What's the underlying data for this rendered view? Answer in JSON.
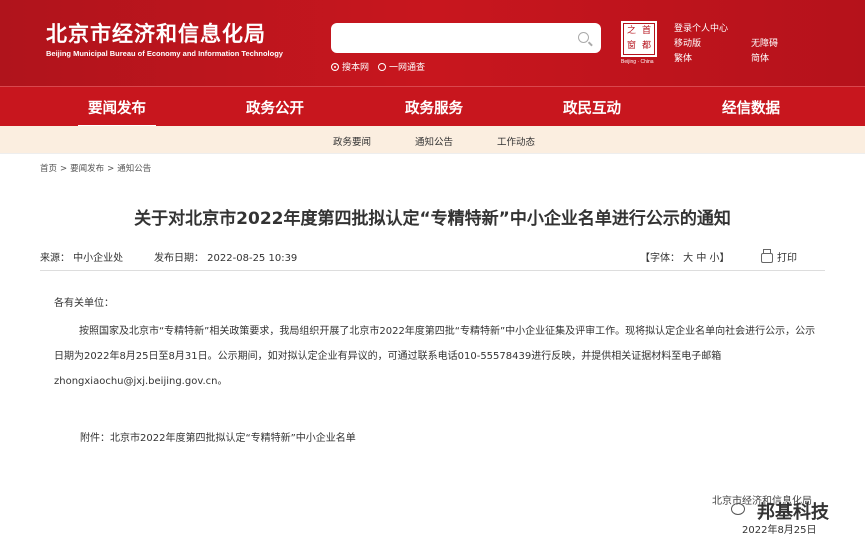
{
  "header": {
    "logo_cn": "北京市经济和信息化局",
    "logo_en": "Beijing Municipal Bureau of Economy and Information Technology",
    "search_placeholder": "",
    "scope_site": "搜本网",
    "scope_all": "一网通查",
    "seal_chars": [
      "首",
      "之",
      "都",
      "窗"
    ],
    "seal_caption": "Beijing · China",
    "links": {
      "login": "登录个人中心",
      "mobile": "移动版",
      "accessible": "无障碍",
      "traditional": "繁体",
      "simplified": "简体"
    }
  },
  "nav": {
    "items": [
      "要闻发布",
      "政务公开",
      "政务服务",
      "政民互动",
      "经信数据"
    ],
    "active": "要闻发布"
  },
  "subnav": {
    "items": [
      "政务要闻",
      "通知公告",
      "工作动态"
    ]
  },
  "breadcrumb": [
    "首页",
    "要闻发布",
    "通知公告"
  ],
  "breadcrumb_sep": ">",
  "article": {
    "title": "关于对北京市2022年度第四批拟认定“专精特新”中小企业名单进行公示的通知",
    "source": "来源：   中小企业处",
    "date": "发布日期：  2022-08-25 10:39",
    "font_size_label": "【字体：  大  中  小】",
    "print_label": "打印",
    "salutation": "各有关单位：",
    "paragraph": "按照国家及北京市“专精特新”相关政策要求，我局组织开展了北京市2022年度第四批“专精特新”中小企业征集及评审工作。现将拟认定企业名单向社会进行公示，公示日期为2022年8月25日至8月31日。公示期间，如对拟认定企业有异议的，可通过联系电话010-55578439进行反映，并提供相关证据材料至电子邮箱zhongxiaochu@jxj.beijing.gov.cn。",
    "attachment": "附件：北京市2022年度第四批拟认定“专精特新”中小企业名单",
    "signer": "北京市经济和信息化局",
    "sign_date": "2022年8月25日"
  },
  "watermark": {
    "brand": "邦基科技"
  },
  "colors": {
    "brand_red": "#c8161e",
    "subnav_bg": "#fbeee0"
  }
}
